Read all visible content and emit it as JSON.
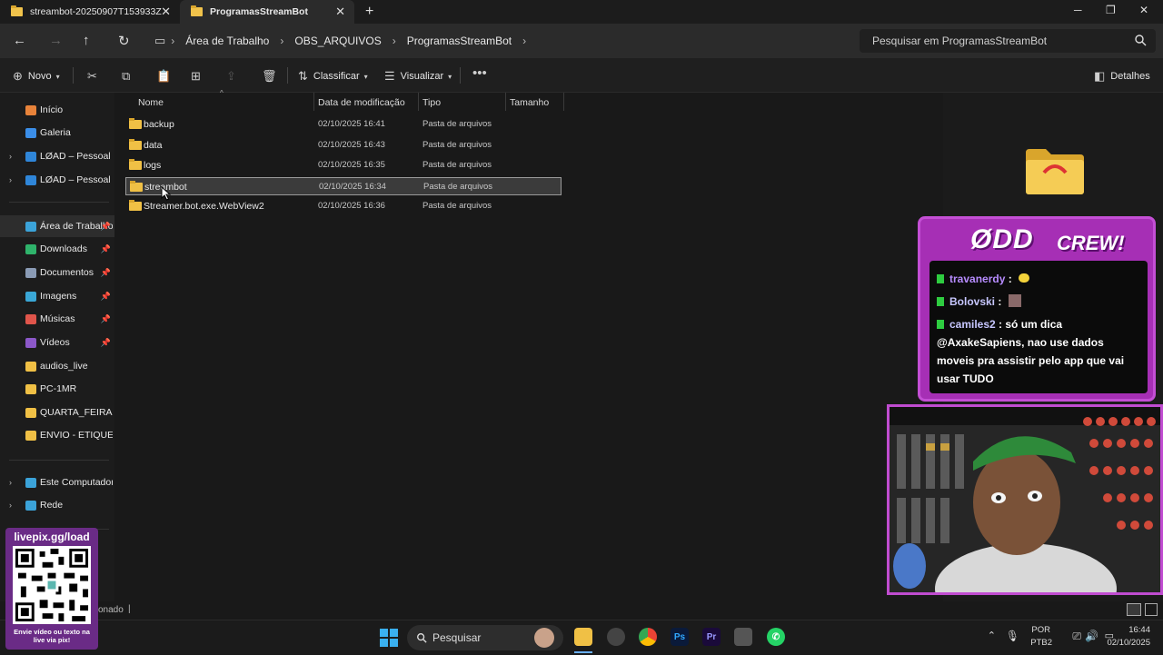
{
  "tabs": [
    {
      "label": "streambot-20250907T153933Z",
      "active": false
    },
    {
      "label": "ProgramasStreamBot",
      "active": true
    }
  ],
  "breadcrumb": [
    "Área de Trabalho",
    "OBS_ARQUIVOS",
    "ProgramasStreamBot"
  ],
  "search": {
    "placeholder": "Pesquisar em ProgramasStreamBot"
  },
  "toolbar": {
    "new_label": "Novo",
    "sort_label": "Classificar",
    "view_label": "Visualizar",
    "details_label": "Detalhes"
  },
  "sidebar": {
    "items": [
      {
        "label": "Início",
        "icon": "home-icon",
        "color": "#e8833a"
      },
      {
        "label": "Galeria",
        "icon": "gallery-icon",
        "color": "#3b8ee8"
      },
      {
        "label": "LØAD – Pessoal",
        "icon": "cloud-icon",
        "color": "#2f86d9",
        "chevron": true
      },
      {
        "label": "LØAD – Pessoal",
        "icon": "cloud-icon",
        "color": "#2f86d9",
        "chevron": true
      },
      {
        "label": "Área de Trabalho",
        "icon": "desktop-icon",
        "color": "#3ba3d9",
        "pinned": true,
        "selected": true
      },
      {
        "label": "Downloads",
        "icon": "download-icon",
        "color": "#2fb36b",
        "pinned": true
      },
      {
        "label": "Documentos",
        "icon": "document-icon",
        "color": "#8a9bb5",
        "pinned": true
      },
      {
        "label": "Imagens",
        "icon": "image-icon",
        "color": "#3aa7d6",
        "pinned": true
      },
      {
        "label": "Músicas",
        "icon": "music-icon",
        "color": "#e0554b",
        "pinned": true
      },
      {
        "label": "Vídeos",
        "icon": "video-icon",
        "color": "#8c58c9",
        "pinned": true
      },
      {
        "label": "audios_live",
        "icon": "folder-icon",
        "color": "#f0c045"
      },
      {
        "label": "PC-1MR",
        "icon": "folder-icon",
        "color": "#f0c045"
      },
      {
        "label": "QUARTA_FEIRA",
        "icon": "folder-icon",
        "color": "#f0c045"
      },
      {
        "label": "ENVIO - ETIQUETAS",
        "icon": "folder-icon",
        "color": "#f0c045"
      },
      {
        "label": "Este Computador",
        "icon": "computer-icon",
        "color": "#3ba3d9",
        "chevron": true
      },
      {
        "label": "Rede",
        "icon": "network-icon",
        "color": "#3ba3d9",
        "chevron": true
      }
    ]
  },
  "columns": [
    "Nome",
    "Data de modificação",
    "Tipo",
    "Tamanho"
  ],
  "files": [
    {
      "name": "backup",
      "date": "02/10/2025 16:41",
      "type": "Pasta de arquivos"
    },
    {
      "name": "data",
      "date": "02/10/2025 16:43",
      "type": "Pasta de arquivos"
    },
    {
      "name": "logs",
      "date": "02/10/2025 16:35",
      "type": "Pasta de arquivos"
    },
    {
      "name": "streambot",
      "date": "02/10/2025 16:34",
      "type": "Pasta de arquivos",
      "selected": true
    },
    {
      "name": "Streamer.bot.exe.WebView2",
      "date": "02/10/2025 16:36",
      "type": "Pasta de arquivos"
    }
  ],
  "status": {
    "text": "onado"
  },
  "taskbar": {
    "search_label": "Pesquisar",
    "lang": "POR",
    "layout": "PTB2",
    "time": "16:44",
    "date": "02/10/2025"
  },
  "overlay": {
    "chat_title": "ØDD",
    "chat_title2": "CREW!",
    "messages": [
      {
        "user": "travanerdy",
        "text": " : "
      },
      {
        "user": "Bolovski",
        "text": " : "
      },
      {
        "user": "camiles2",
        "text": " : só um dica @AxakeSapiens, nao use dados moveis pra assistir pelo app que vai usar TUDO"
      }
    ],
    "qr_title": "livepix.gg/load",
    "qr_sub": "Envie vídeo ou texto na live via pix!"
  },
  "colors": {
    "accent": "#a62fb5",
    "folder": "#f0c045"
  }
}
